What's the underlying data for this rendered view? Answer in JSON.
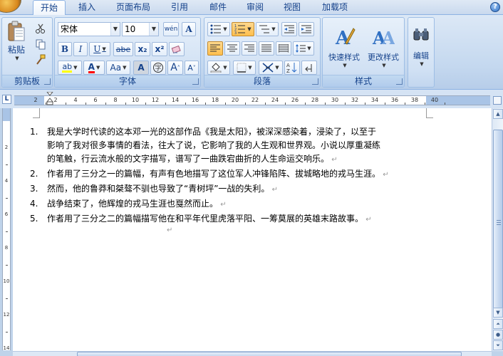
{
  "tabs": {
    "home": "开始",
    "insert": "插入",
    "page_layout": "页面布局",
    "references": "引用",
    "mailings": "邮件",
    "review": "审阅",
    "view": "视图",
    "addins": "加载项"
  },
  "ribbon": {
    "clipboard": {
      "label": "剪贴板",
      "paste_label": "粘贴"
    },
    "font": {
      "label": "字体",
      "font_name": "宋体",
      "font_size": "10",
      "buttons": {
        "bold": "B",
        "italic": "I",
        "underline": "U",
        "strikethrough": "abe",
        "subscript": "x₂",
        "superscript": "x²",
        "change_case": "Aa",
        "char_shading": "A",
        "grow_font": "A",
        "shrink_font": "A",
        "phonetic": "wén",
        "char_border": "A",
        "highlight": "ab",
        "font_color": "A"
      }
    },
    "paragraph": {
      "label": "段落"
    },
    "styles": {
      "label": "样式",
      "quick_styles": "快速样式",
      "change_styles": "更改样式"
    },
    "editing": {
      "label": "编辑"
    }
  },
  "ruler": {
    "corner_symbol": "L",
    "h_labels": [
      "2",
      "2",
      "4",
      "6",
      "8",
      "10",
      "12",
      "14",
      "16",
      "18",
      "20",
      "22",
      "24",
      "26",
      "28",
      "30",
      "32",
      "34",
      "36",
      "38",
      "40"
    ],
    "v_labels": [
      "2",
      "4",
      "6",
      "8",
      "10",
      "12",
      "14"
    ]
  },
  "document": {
    "list": [
      {
        "num": "1.",
        "lines": [
          "我是大学时代读的这本邓一光的这部作品《我是太阳》，被深深感染着，浸染了，以至于",
          "影响了我对很多事情的看法，往大了说，它影响了我的人生观和世界观。小说以厚重凝练",
          "的笔触，行云流水般的文字描写，谱写了一曲跌宕曲折的人生命运交响乐。"
        ]
      },
      {
        "num": "2.",
        "lines": [
          "作者用了三分之一的篇幅，有声有色地描写了这位军人冲锋陷阵、拔城略地的戎马生涯。"
        ]
      },
      {
        "num": "3.",
        "lines": [
          "然而，他的鲁莽和桀骜不驯也导致了“青树坪”一战的失利。"
        ]
      },
      {
        "num": "4.",
        "lines": [
          "战争结束了，他辉煌的戎马生涯也戛然而止。"
        ]
      },
      {
        "num": "5.",
        "lines": [
          "作者用了三分之二的篇幅描写他在和平年代里虎落平阳、一筹莫展的英雄末路故事。"
        ]
      }
    ],
    "paragraph_mark": "↵"
  },
  "colors": {
    "accent": "#15428b",
    "ribbon_bg": "#c4d8ef",
    "pressed": "#ffbf4d",
    "highlight_yellow": "#ffff00",
    "font_red": "#ff0000"
  }
}
